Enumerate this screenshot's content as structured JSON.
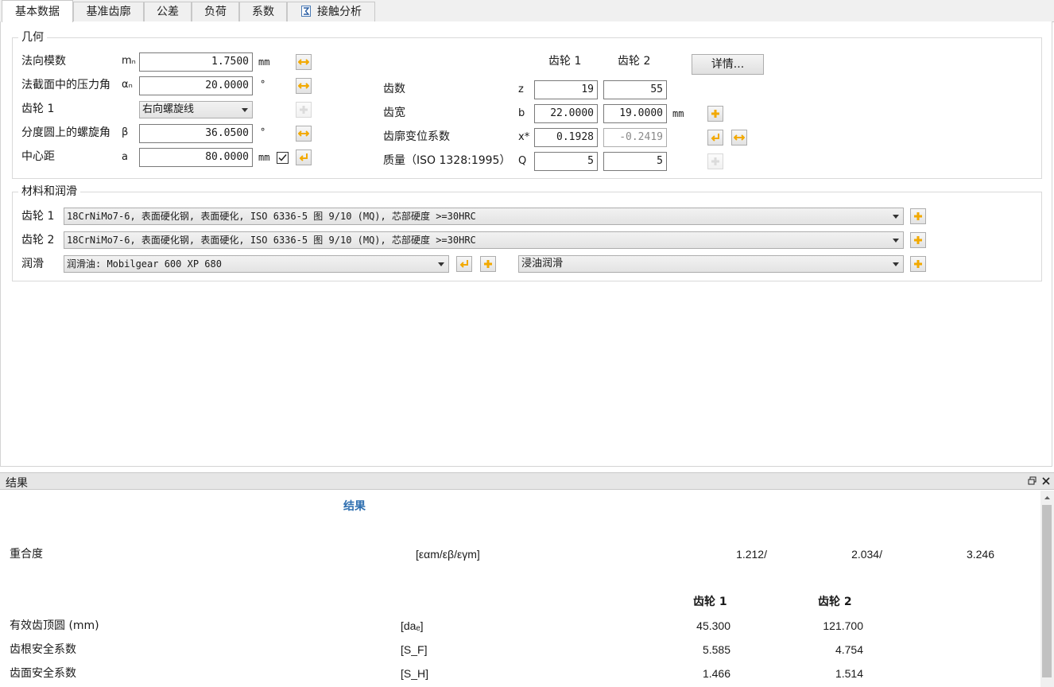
{
  "tabs": [
    "基本数据",
    "基准齿廓",
    "公差",
    "负荷",
    "系数",
    "接触分析"
  ],
  "geometry": {
    "title": "几何",
    "rows": [
      {
        "label": "法向模数",
        "symbol": "mₙ",
        "value": "1.7500",
        "unit": "mm"
      },
      {
        "label": "法截面中的压力角",
        "symbol": "αₙ",
        "value": "20.0000",
        "unit": "°"
      },
      {
        "label": "齿轮 1",
        "symbol": "",
        "value": "右向螺旋线",
        "unit": ""
      },
      {
        "label": "分度圆上的螺旋角",
        "symbol": "β",
        "value": "36.0500",
        "unit": "°"
      },
      {
        "label": "中心距",
        "symbol": "a",
        "value": "80.0000",
        "unit": "mm"
      }
    ],
    "center_distance_checked": true,
    "gear_headers": [
      "齿轮 1",
      "齿轮 2"
    ],
    "details_button": "详情...",
    "gear_rows": [
      {
        "label": "齿数",
        "symbol": "z",
        "v1": "19",
        "v2": "55",
        "unit": ""
      },
      {
        "label": "齿宽",
        "symbol": "b",
        "v1": "22.0000",
        "v2": "19.0000",
        "unit": "mm"
      },
      {
        "label": "齿廓变位系数",
        "symbol": "x*",
        "v1": "0.1928",
        "v2": "-0.2419",
        "unit": ""
      },
      {
        "label": "质量（ISO 1328:1995）",
        "symbol": "Q",
        "v1": "5",
        "v2": "5",
        "unit": ""
      }
    ]
  },
  "material": {
    "title": "材料和润滑",
    "gear1_label": "齿轮 1",
    "gear1_value": "18CrNiMo7-6, 表面硬化钢, 表面硬化, ISO 6336-5 图 9/10 (MQ), 芯部硬度 >=30HRC",
    "gear2_label": "齿轮 2",
    "gear2_value": "18CrNiMo7-6, 表面硬化钢, 表面硬化, ISO 6336-5 图 9/10 (MQ), 芯部硬度 >=30HRC",
    "lube_label": "润滑",
    "lube_value": "润滑油: Mobilgear 600 XP 680",
    "lube_type": "浸油润滑"
  },
  "results": {
    "panel_title": "结果",
    "heading": "结果",
    "contact_ratio": {
      "label": "重合度",
      "symbol": "[εαm/εβ/εγm]",
      "v1": "1.212/",
      "v2": "2.034/",
      "v3": "3.246"
    },
    "col_headers": [
      "齿轮 1",
      "齿轮 2"
    ],
    "rows": [
      {
        "label": "有效齿顶圆 (mm)",
        "symbol": "[daₑ]",
        "v1": "45.300",
        "v2": "121.700"
      },
      {
        "label": "齿根安全系数",
        "symbol": "[S_F]",
        "v1": "5.585",
        "v2": "4.754"
      },
      {
        "label": "齿面安全系数",
        "symbol": "[S_H]",
        "v1": "1.466",
        "v2": "1.514"
      }
    ]
  },
  "colors": {
    "accent_icon": "#f2a900",
    "result_heading": "#2f6fb0"
  }
}
